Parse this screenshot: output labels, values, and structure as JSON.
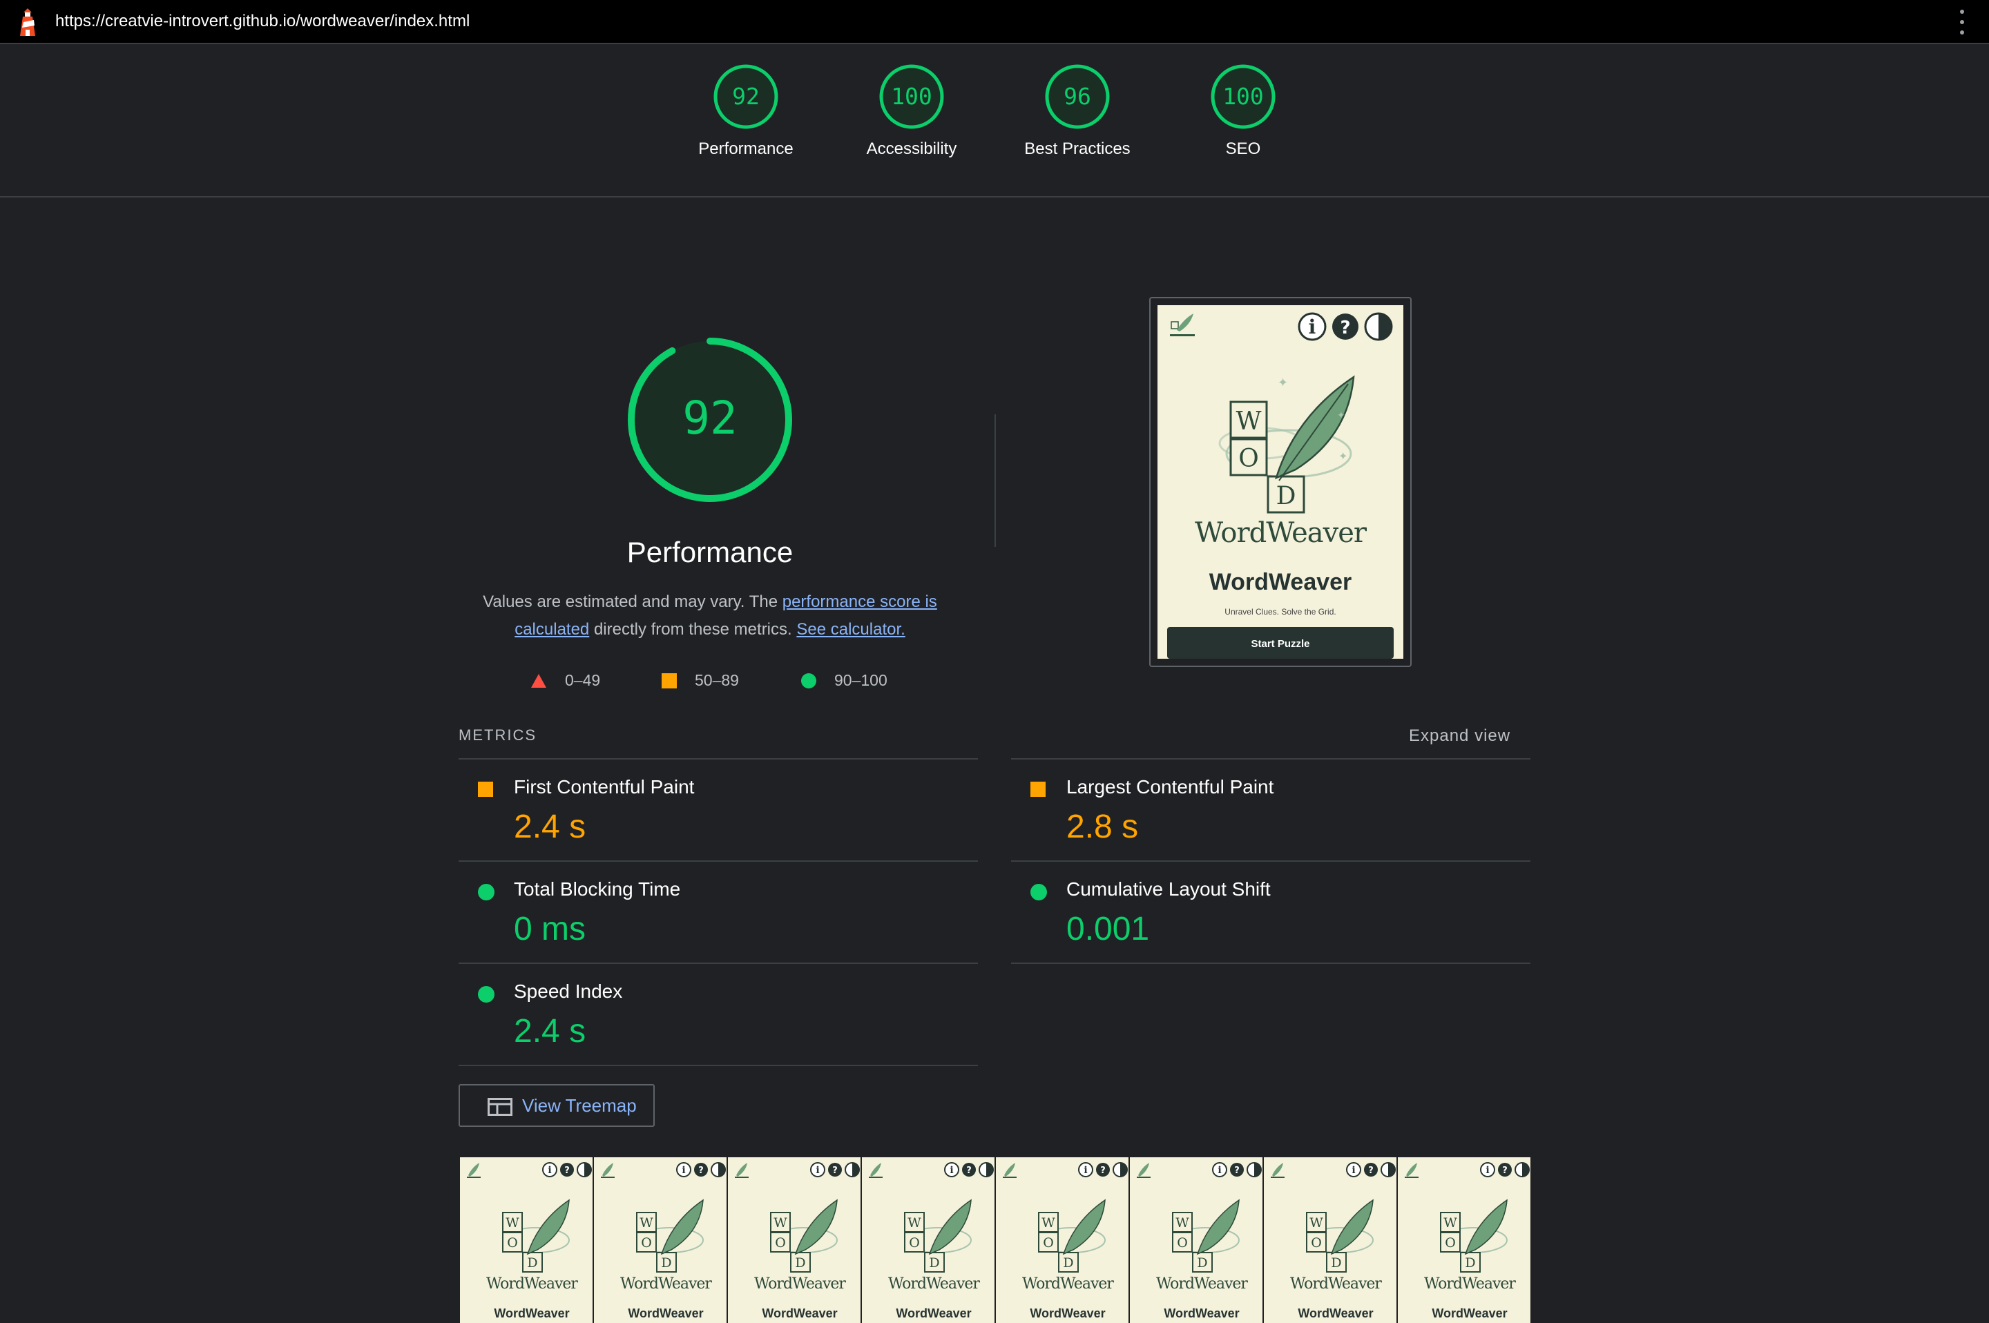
{
  "browser": {
    "url": "https://creatvie-introvert.github.io/wordweaver/index.html"
  },
  "scores": [
    {
      "value": "92",
      "label": "Performance"
    },
    {
      "value": "100",
      "label": "Accessibility"
    },
    {
      "value": "96",
      "label": "Best Practices"
    },
    {
      "value": "100",
      "label": "SEO"
    }
  ],
  "performance": {
    "score": "92",
    "title": "Performance",
    "desc_prefix": "Values are estimated and may vary. The ",
    "desc_link1": "performance score is calculated",
    "desc_middle": " directly from these metrics. ",
    "desc_link2": "See calculator."
  },
  "legend": [
    {
      "label": "0–49"
    },
    {
      "label": "50–89"
    },
    {
      "label": "90–100"
    }
  ],
  "metrics": {
    "heading": "METRICS",
    "expand_label": "Expand view",
    "items": [
      {
        "title": "First Contentful Paint",
        "value": "2.4 s",
        "status": "average"
      },
      {
        "title": "Largest Contentful Paint",
        "value": "2.8 s",
        "status": "average"
      },
      {
        "title": "Total Blocking Time",
        "value": "0 ms",
        "status": "pass"
      },
      {
        "title": "Cumulative Layout Shift",
        "value": "0.001",
        "status": "pass"
      },
      {
        "title": "Speed Index",
        "value": "2.4 s",
        "status": "pass"
      }
    ]
  },
  "treemap": {
    "label": "View Treemap"
  },
  "app_preview": {
    "logo_letters": [
      "W",
      "O",
      "D"
    ],
    "logo_wordmark": "WordWeaver",
    "title": "WordWeaver",
    "tagline": "Unravel Clues. Solve the Grid.",
    "cta": "Start Puzzle"
  },
  "filmstrip": {
    "frame_count": 8,
    "frame_title": "WordWeaver"
  },
  "colors": {
    "pass": "#0cce6b",
    "average": "#ffa400",
    "fail": "#ff4e42",
    "background": "#202124",
    "app_bg": "#f5f2dc",
    "app_dark": "#263330",
    "app_green": "#2e5a40"
  },
  "icons": {
    "lighthouse": "lighthouse-icon",
    "kebab": "more-vert-icon",
    "treemap": "treemap-icon"
  }
}
